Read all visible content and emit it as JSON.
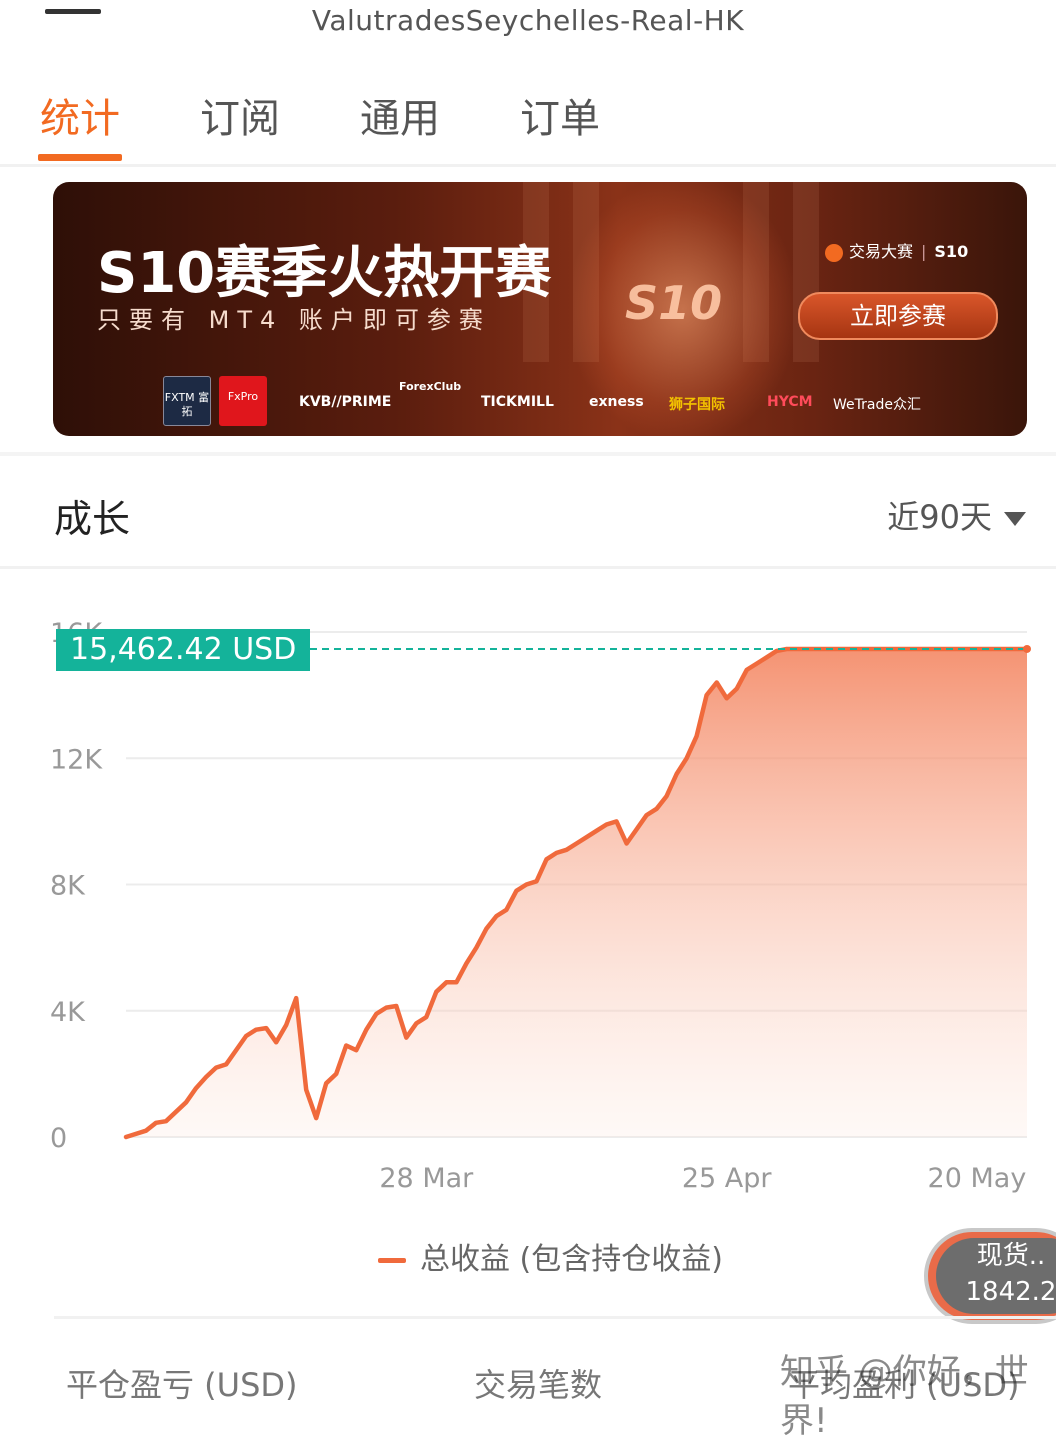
{
  "header": {
    "title": "ValutradesSeychelles-Real-HK"
  },
  "tabs": [
    {
      "label": "统计",
      "active": true
    },
    {
      "label": "订阅",
      "active": false
    },
    {
      "label": "通用",
      "active": false
    },
    {
      "label": "订单",
      "active": false
    }
  ],
  "banner": {
    "headline": "S10赛季火热开赛",
    "subtitle": "只要有 MT4 账户即可参赛",
    "season_mark": "S10",
    "brand": "交易大赛",
    "brand_season": "S10",
    "cta": "立即参赛",
    "sponsors": [
      "FXTM 富拓",
      "FxPro",
      "KVB//PRIME",
      "ForexClub",
      "TICKMILL",
      "exness",
      "狮子国际",
      "HYCM",
      "WeTrade众汇"
    ]
  },
  "growth": {
    "title": "成长",
    "range": "近90天"
  },
  "chart_data": {
    "type": "area",
    "tooltip": "15,462.42 USD",
    "y_ticks": [
      "0",
      "4K",
      "8K",
      "12K",
      "16K"
    ],
    "x_ticks": [
      "28 Mar",
      "25 Apr",
      "20 May"
    ],
    "ylim": [
      0,
      16000
    ],
    "xlim": [
      0,
      90
    ],
    "x_tick_positions": [
      30,
      60,
      85
    ],
    "series": [
      {
        "name": "总收益 (包含持仓收益)",
        "color": "#f06a3c",
        "x": [
          0,
          2,
          3,
          4,
          6,
          7,
          8,
          9,
          10,
          12,
          13,
          14,
          15,
          16,
          17,
          18,
          19,
          20,
          21,
          22,
          23,
          24,
          25,
          26,
          27,
          28,
          29,
          30,
          31,
          32,
          33,
          34,
          35,
          36,
          37,
          38,
          39,
          40,
          41,
          42,
          43,
          44,
          45,
          46,
          47,
          48,
          49,
          50,
          51,
          52,
          53,
          54,
          55,
          56,
          57,
          58,
          59,
          60,
          61,
          62,
          63,
          64,
          65,
          66,
          67,
          68,
          69,
          70,
          71,
          72,
          73,
          74,
          75,
          76,
          77,
          78,
          79,
          80,
          81,
          82,
          83,
          84,
          85,
          86,
          87,
          88,
          89,
          90
        ],
        "y": [
          0,
          200,
          450,
          500,
          1100,
          1550,
          1900,
          2200,
          2300,
          3200,
          3400,
          3450,
          3000,
          3550,
          4400,
          1500,
          600,
          1700,
          2000,
          2900,
          2750,
          3400,
          3900,
          4100,
          4150,
          3150,
          3600,
          3800,
          4600,
          4900,
          4900,
          5500,
          6000,
          6600,
          7000,
          7200,
          7800,
          8000,
          8100,
          8800,
          9000,
          9100,
          9300,
          9500,
          9700,
          9900,
          10000,
          9300,
          9750,
          10200,
          10400,
          10800,
          11500,
          12000,
          12700,
          14000,
          14400,
          13900,
          14200,
          14800,
          15000,
          15200,
          15400,
          15462,
          15462,
          15462,
          15462,
          15462,
          15462,
          15462,
          15462,
          15462,
          15462,
          15462,
          15462,
          15462,
          15462,
          15462,
          15462,
          15462,
          15462,
          15462,
          15462,
          15462,
          15462,
          15462,
          15462,
          15462
        ]
      }
    ]
  },
  "legend": {
    "label": "总收益 (包含持仓收益)"
  },
  "floating": {
    "line1": "现货..",
    "line2": "1842.2"
  },
  "stats": {
    "closed_pnl": "平仓盈亏 (USD)",
    "trade_count": "交易笔数",
    "avg_profit": "平均盈利 (USD)"
  },
  "watermark": "知乎 @你好，世界!"
}
